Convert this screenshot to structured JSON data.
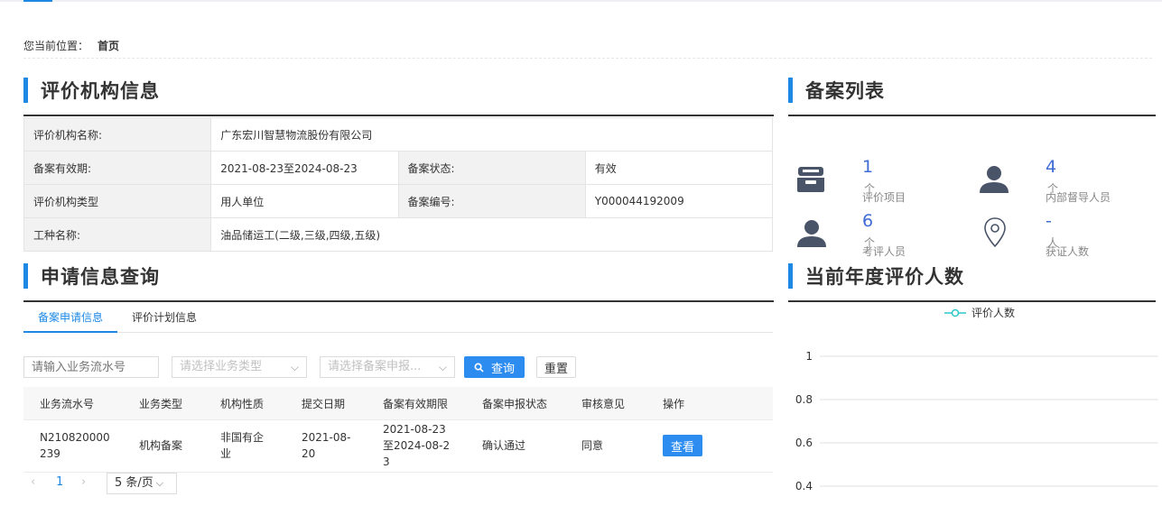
{
  "breadcrumb": {
    "label": "您当前位置：",
    "current": "首页"
  },
  "org_section": {
    "title": "评价机构信息",
    "rows": {
      "name_label": "评价机构名称:",
      "name_value": "广东宏川智慧物流股份有限公司",
      "validity_label": "备案有效期:",
      "validity_value": "2021-08-23至2024-08-23",
      "status_label": "备案状态:",
      "status_value": "有效",
      "type_label": "评价机构类型",
      "type_value": "用人单位",
      "number_label": "备案编号:",
      "number_value": "Y000044192009",
      "job_label": "工种名称:",
      "job_value": "油品储运工(二级,三级,四级,五级)"
    }
  },
  "filing_section": {
    "title": "备案列表",
    "stats": [
      {
        "num": "1",
        "unit": "个",
        "label": "评价项目",
        "icon": "inbox-icon"
      },
      {
        "num": "4",
        "unit": "个",
        "label": "内部督导人员",
        "icon": "user-icon"
      },
      {
        "num": "6",
        "unit": "个",
        "label": "考评人员",
        "icon": "user-icon"
      },
      {
        "num": "-",
        "unit": "人",
        "label": "获证人数",
        "icon": "location-pin-icon"
      }
    ]
  },
  "apply_section": {
    "title": "申请信息查询",
    "tabs": [
      "备案申请信息",
      "评价计划信息"
    ],
    "filters": {
      "serial_placeholder": "请输入业务流水号",
      "type_placeholder": "请选择业务类型",
      "status_placeholder": "请选择备案申报..."
    },
    "query_label": "查询",
    "reset_label": "重置",
    "columns": [
      "业务流水号",
      "业务类型",
      "机构性质",
      "提交日期",
      "备案有效期限",
      "备案申报状态",
      "审核意见",
      "操作"
    ],
    "rows": [
      {
        "serial": [
          "N210820000",
          "239"
        ],
        "biz_type": "机构备案",
        "nature": [
          "非国有企",
          "业"
        ],
        "date": [
          "2021-08-",
          "20"
        ],
        "validity": [
          "2021-08-23",
          "至2024-08-2",
          "3"
        ],
        "status": "确认通过",
        "opinion": "同意",
        "action": "查看"
      }
    ],
    "pager": {
      "prev": "‹",
      "page": "1",
      "next": "›",
      "page_size": "5 条/页"
    }
  },
  "chart_section": {
    "title": "当前年度评价人数",
    "colors": {
      "series": "#2ec7c9",
      "grid": "#e0e0e0",
      "text": "#333333"
    }
  },
  "chart_data": {
    "type": "line",
    "series": [
      {
        "name": "评价人数",
        "values": []
      }
    ],
    "yticks": [
      "1",
      "0.8",
      "0.6",
      "0.4"
    ],
    "ytick_values": [
      1,
      0.8,
      0.6,
      0.4
    ],
    "ylim": [
      0,
      1
    ],
    "grid": true,
    "legend": "top-center"
  }
}
